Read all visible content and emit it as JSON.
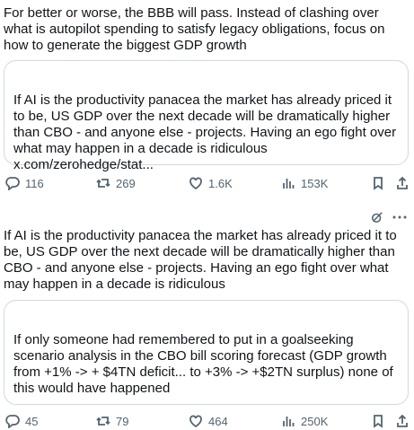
{
  "post1": {
    "text": "For better or worse, the BBB will pass. Instead of clashing over what is autopilot spending to satisfy legacy obligations, focus on how to generate the biggest GDP growth",
    "quote": "If AI is the productivity panacea the market has already priced it to be, US GDP over the next decade will be dramatically higher than CBO - and anyone else - projects. Having an ego fight over what may happen in a decade is ridiculous x.com/zerohedge/stat...",
    "replies": "116",
    "reposts": "269",
    "likes": "1.6K",
    "views": "153K"
  },
  "post2": {
    "text": "If AI is the productivity panacea the market has already priced it to be, US GDP over the next decade will be dramatically higher than CBO - and anyone else - projects. Having an ego fight over what may happen in a decade is ridiculous",
    "quote": "If only someone had remembered to put in a goalseeking scenario analysis in the CBO bill scoring forecast (GDP growth from +1% -> + $4TN deficit... to +3% -> +$2TN surplus) none of this would have happened",
    "replies": "45",
    "reposts": "79",
    "likes": "464",
    "views": "250K"
  },
  "icons": {
    "reply": "reply-icon",
    "repost": "repost-icon",
    "like": "heart-icon",
    "views": "views-chart-icon",
    "bookmark": "bookmark-icon",
    "share": "share-icon",
    "grok": "grok-icon",
    "more": "more-icon"
  }
}
